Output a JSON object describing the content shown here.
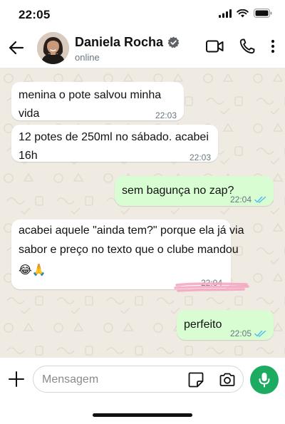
{
  "status_bar": {
    "time": "22:05"
  },
  "header": {
    "contact_name": "Daniela Rocha",
    "contact_status": "online",
    "verified": true
  },
  "messages": [
    {
      "direction": "incoming",
      "text": "menina o pote salvou minha vida",
      "time": "22:03"
    },
    {
      "direction": "incoming",
      "text": "12 potes de 250ml no sábado. acabei 16h",
      "time": "22:03"
    },
    {
      "direction": "outgoing",
      "text": "sem bagunça no zap?",
      "time": "22:04",
      "status": "read"
    },
    {
      "direction": "incoming",
      "text_line1": "acabei aquele \"ainda tem?\" porque ela já via",
      "text_line2": "sabor e preço no texto que o clube mandou",
      "text_line3": "😂🙏",
      "time": "22:04"
    },
    {
      "direction": "outgoing",
      "text": "perfeito",
      "time": "22:05",
      "status": "read"
    }
  ],
  "composer": {
    "placeholder": "Mensagem"
  },
  "colors": {
    "chat_background": "#efeae2",
    "incoming_bubble": "#ffffff",
    "outgoing_bubble": "#d9fdd3",
    "read_ticks": "#53bdeb",
    "mic_button": "#1daa61",
    "highlight_marker": "#f4a3bf"
  },
  "icons": [
    "back-arrow-icon",
    "verified-badge-icon",
    "video-call-icon",
    "phone-icon",
    "more-options-icon",
    "plus-icon",
    "sticker-icon",
    "camera-icon",
    "microphone-icon",
    "signal-icon",
    "wifi-icon",
    "battery-icon",
    "double-check-icon"
  ]
}
